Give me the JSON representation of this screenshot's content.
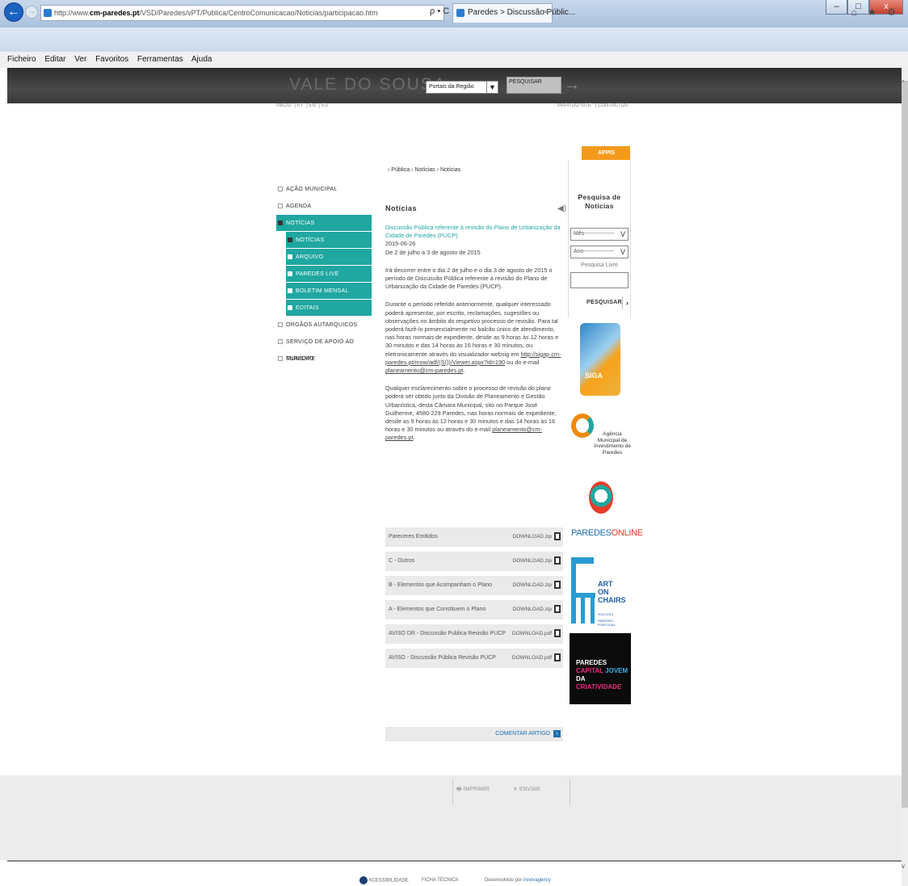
{
  "window": {
    "minimize": "–",
    "maximize": "□",
    "close": "x"
  },
  "browser": {
    "url_prefix": "http://www.",
    "url_domain": "cm-paredes.pt",
    "url_path": "/VSD/Paredes/vPT/Publica/CentroComunicacao/Noticias/participacao.htm",
    "search_glyph": "ρ • C",
    "tab_title": "Paredes > Discussão Públic...",
    "tab_close": "×",
    "toolbar_icons": "⌂ ★ ⚙"
  },
  "menubar": [
    "Ficheiro",
    "Editar",
    "Ver",
    "Favoritos",
    "Ferramentas",
    "Ajuda"
  ],
  "header": {
    "logo": "VALE DO SOUSA",
    "portal_select": "Portais da Região",
    "search_placeholder": "PESQUISAR",
    "lang": [
      "INÍCIO",
      "PT",
      "EN",
      "ES"
    ],
    "top_links": [
      "MAPA DO SITE",
      "CONTACTOS"
    ]
  },
  "breadcrumb": "› Pública › Notícias › Notícias",
  "sidebar": {
    "items": [
      {
        "label": "AÇÃO MUNICIPAL"
      },
      {
        "label": "AGENDA"
      },
      {
        "label": "NOTÍCIAS"
      },
      {
        "label": "NOTÍCIAS"
      },
      {
        "label": "ARQUIVO"
      },
      {
        "label": "PAREDES LIVE"
      },
      {
        "label": "BOLETIM MENSAL"
      },
      {
        "label": "EDITAIS"
      },
      {
        "label": "ORGÃOS AUTARQUICOS"
      },
      {
        "label": "SERVIÇO DE APOIO AO MUNÍCIPE"
      },
      {
        "label": "TURISMO"
      }
    ]
  },
  "main": {
    "title": "Notícias",
    "article_title": "Discussão Pública referente à revisão do Plano de Urbanização da Cidade de Paredes (PUCP)",
    "date": "2015-06-26",
    "period": "De 2 de julho a 3 de agosto de 2015",
    "p1": "Irá decorrer entre o dia 2 de julho e o dia 3 de agosto de 2015 o período de Discussão Pública referente à revisão do Plano de Urbanização da Cidade de Paredes (PUCP).",
    "p2_text": "Durante o período referido anteriormente, qualquer interessado poderá apresentar, por escrito, reclamações, sugestões ou observações no âmbito do respetivo processo de revisão. Para tal poderá fazê-lo presencialmente no balcão único de atendimento, nas horas normais de expediente, desde as 9 horas às 12 horas e 30 minutos e das 14 horas às 16 horas e 30 minutos, ou eletronicamente através do visualizador websig em ",
    "p2_link": "http://sigap.cm-paredes.pt/mow/adf/(S())/Viewer.aspx?id=190",
    "p2_mid": " ou do e-mail ",
    "p2_email": "planeamento@cm-paredes.pt",
    "p2_end": ".",
    "p3_text": "Qualquer esclarecimento sobre o processo de revisão do plano poderá ser obtido junto da Divisão de Planeamento e Gestão Urbanística, desta Câmara Municipal, sito no Parque José Guilherme, 4580-229 Paredes, nas horas normais de expediente, desde as 9 horas às 12 horas e 30 minutos e das 14 horas às 16 horas e 30 minutos ou através do e-mail ",
    "p3_email": "planeamento@cm-paredes.pt",
    "p3_end": ".",
    "downloads": [
      {
        "name": "Pareceres Emitidos",
        "link": "DOWNLOAD.zip"
      },
      {
        "name": "C - Outros",
        "link": "DOWNLOAD.zip"
      },
      {
        "name": "B - Elementos que Acompanham o Plano",
        "link": "DOWNLOAD.zip"
      },
      {
        "name": "A - Elementos que Constituem o Plano",
        "link": "DOWNLOAD.zip"
      },
      {
        "name": "AVISO DR - Discussão Publica Revisão PUCP",
        "link": "DOWNLOAD.pdf"
      },
      {
        "name": "AVISO - Discussão Pública Revisão PUCP",
        "link": "DOWNLOAD.pdf"
      }
    ],
    "comment": "COMENTAR ARTIGO"
  },
  "right": {
    "appis": "APPIS",
    "search_title": "Pesquisa de Notícias",
    "month": "Mês----------------",
    "year": "Ano----------------",
    "free_search": "Pesquisa Livre",
    "search_button": "PESQUISAR",
    "siga": "SIGA",
    "amip": "Agência Municipal de Investimento de Paredes",
    "po_a": "PAREDES",
    "po_b": "ONLINE",
    "aoc": "ART ON CHAIRS",
    "aoc_years": "2014-2015",
    "aoc_sub": "PAREDES . PORTUGAL",
    "pcj_a": "PAREDES",
    "pcj_b": "CAPITAL",
    "pcj_c": "JOVEM",
    "pcj_d": "DA",
    "pcj_e": "CRIATIVIDADE"
  },
  "footer": {
    "print": "IMPRIMIR",
    "send": "ENVIAR",
    "accessibility": "ACESSIBILIDADE",
    "ficha": "FICHA TÉCNICA",
    "dev_prefix": "Desenvolvido por ",
    "dev_name": "innovagency"
  }
}
